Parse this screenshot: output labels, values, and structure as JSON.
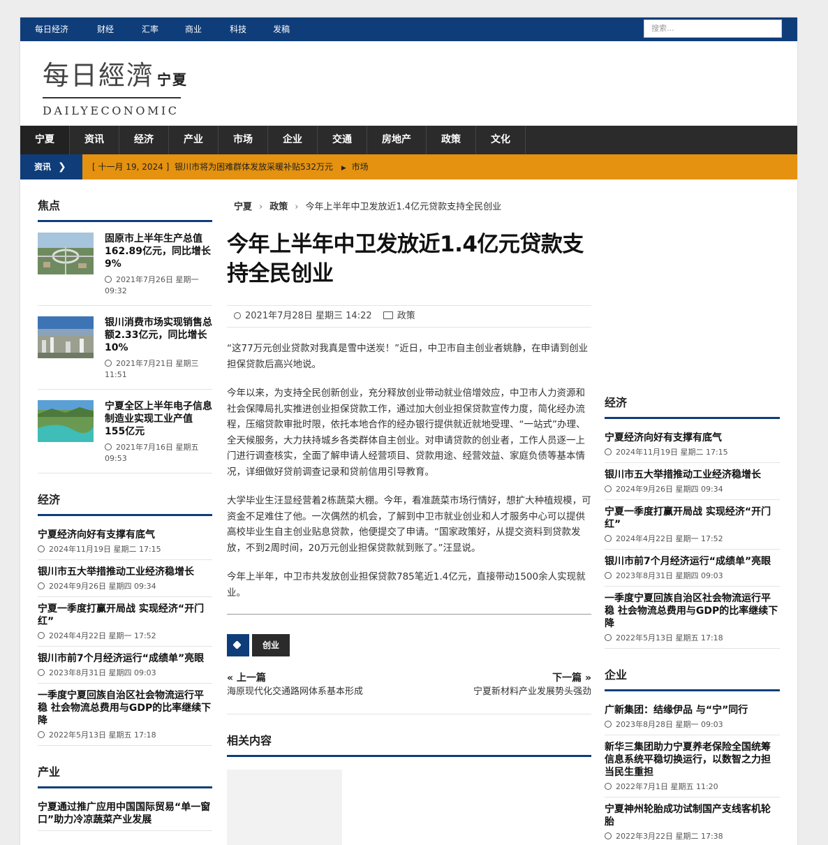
{
  "topnav": [
    "每日经济",
    "财经",
    "汇率",
    "商业",
    "科技",
    "发稿"
  ],
  "search": {
    "placeholder": "搜索..."
  },
  "logo": {
    "cn": "每日經濟",
    "tag": "宁夏",
    "en": "DAILYECONOMIC"
  },
  "mainnav": [
    "宁夏",
    "资讯",
    "经济",
    "产业",
    "市场",
    "企业",
    "交通",
    "房地产",
    "政策",
    "文化"
  ],
  "ticker": {
    "label": "资讯",
    "date": "[ 十一月 19, 2024 ]",
    "headline": "银川市将为困难群体发放采暖补贴532万元",
    "category": "市场"
  },
  "left": {
    "focus_title": "焦点",
    "focus": [
      {
        "title": "固原市上半年生产总值162.89亿元，同比增长9%",
        "date": "2021年7月26日 星期一 09:32"
      },
      {
        "title": "银川消费市场实现销售总额2.33亿元，同比增长10%",
        "date": "2021年7月21日 星期三 11:51"
      },
      {
        "title": "宁夏全区上半年电子信息制造业实现工业产值155亿元",
        "date": "2021年7月16日 星期五 09:53"
      }
    ],
    "econ_title": "经济",
    "econ": [
      {
        "title": "宁夏经济向好有支撑有底气",
        "date": "2024年11月19日 星期二 17:15"
      },
      {
        "title": "银川市五大举措推动工业经济稳增长",
        "date": "2024年9月26日 星期四 09:34"
      },
      {
        "title": "宁夏一季度打赢开局战 实现经济“开门红”",
        "date": "2024年4月22日 星期一 17:52"
      },
      {
        "title": "银川市前7个月经济运行“成绩单”亮眼",
        "date": "2023年8月31日 星期四 09:03"
      },
      {
        "title": "一季度宁夏回族自治区社会物流运行平稳 社会物流总费用与GDP的比率继续下降",
        "date": "2022年5月13日 星期五 17:18"
      }
    ],
    "industry_title": "产业",
    "industry": [
      {
        "title": "宁夏通过推广应用中国国际贸易“单一窗口”助力冷凉蔬菜产业发展"
      }
    ]
  },
  "article": {
    "crumb": [
      "宁夏",
      "政策",
      "今年上半年中卫发放近1.4亿元贷款支持全民创业"
    ],
    "title": "今年上半年中卫发放近1.4亿元贷款支持全民创业",
    "date": "2021年7月28日 星期三 14:22",
    "category": "政策",
    "paragraphs": [
      "“这77万元创业贷款对我真是雪中送炭！”近日，中卫市自主创业者姚静，在申请到创业担保贷款后高兴地说。",
      "今年以来，为支持全民创新创业，充分释放创业带动就业倍增效应，中卫市人力资源和社会保障局扎实推进创业担保贷款工作，通过加大创业担保贷款宣传力度，简化经办流程，压缩贷款审批时限，依托本地合作的经办银行提供就近就地受理、“一站式”办理、全天候服务，大力扶持城乡各类群体自主创业。对申请贷款的创业者，工作人员逐一上门进行调查核实，全面了解申请人经营项目、贷款用途、经营效益、家庭负债等基本情况，详细做好贷前调查记录和贷前信用引导教育。",
      "大学毕业生汪显经营着2栋蔬菜大棚。今年，看准蔬菜市场行情好，想扩大种植规模，可资金不足难住了他。一次偶然的机会，了解到中卫市就业创业和人才服务中心可以提供高校毕业生自主创业贴息贷款，他便提交了申请。“国家政策好，从提交资料到贷款发放，不到2周时间，20万元创业担保贷款就到账了。”汪显说。",
      "今年上半年，中卫市共发放创业担保贷款785笔近1.4亿元，直接带动1500余人实现就业。"
    ],
    "tag": "创业",
    "prev_label": "« 上一篇",
    "prev_title": "海原现代化交通路网体系基本形成",
    "next_label": "下一篇 »",
    "next_title": "宁夏新材料产业发展势头强劲",
    "related_title": "相关内容"
  },
  "right": {
    "econ_title": "经济",
    "econ": [
      {
        "title": "宁夏经济向好有支撑有底气",
        "date": "2024年11月19日 星期二 17:15"
      },
      {
        "title": "银川市五大举措推动工业经济稳增长",
        "date": "2024年9月26日 星期四 09:34"
      },
      {
        "title": "宁夏一季度打赢开局战 实现经济“开门红”",
        "date": "2024年4月22日 星期一 17:52"
      },
      {
        "title": "银川市前7个月经济运行“成绩单”亮眼",
        "date": "2023年8月31日 星期四 09:03"
      },
      {
        "title": "一季度宁夏回族自治区社会物流运行平稳 社会物流总费用与GDP的比率继续下降",
        "date": "2022年5月13日 星期五 17:18"
      }
    ],
    "biz_title": "企业",
    "biz": [
      {
        "title": "广新集团：结缘伊品 与“宁”同行",
        "date": "2023年8月28日 星期一 09:03"
      },
      {
        "title": "新华三集团助力宁夏养老保险全国统筹信息系统平稳切换运行，以数智之力担当民生重担",
        "date": "2022年7月1日 星期五 11:20"
      },
      {
        "title": "宁夏神州轮胎成功试制国产支线客机轮胎",
        "date": "2022年3月22日 星期二 17:38"
      }
    ]
  },
  "colors": {
    "nav_blue": "#0f3d7a",
    "ticker_orange": "#e4920f",
    "dark_nav": "#2b2b2b"
  }
}
